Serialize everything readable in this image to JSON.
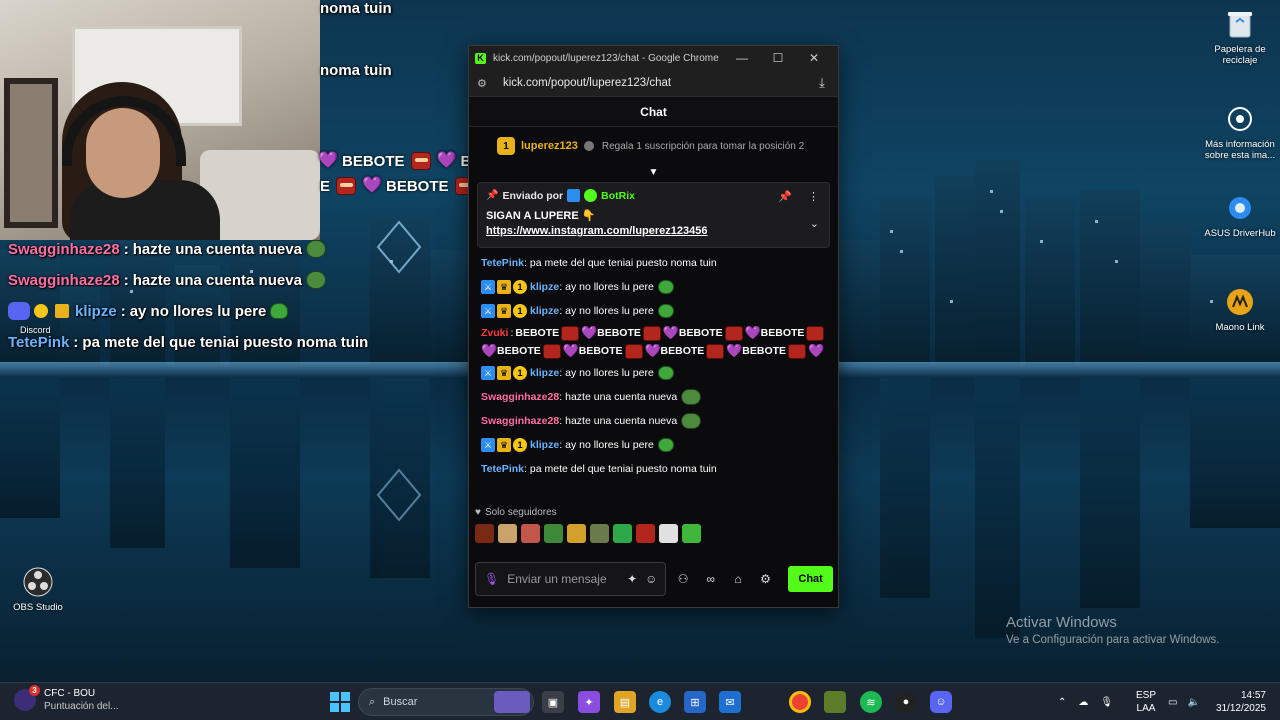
{
  "overlay": {
    "noma_top_1": "noma tuin",
    "noma_top_2": "noma tuin",
    "bebote_word": "BEBOTE",
    "bebote_cut": "E",
    "chat_lines": [
      {
        "user": "Swagginhaze28",
        "sep": " : ",
        "msg": "hazte una cuenta nueva"
      },
      {
        "user": "Swagginhaze28",
        "sep": " : ",
        "msg": "hazte una cuenta nueva"
      },
      {
        "user": "klipze",
        "sep": " : ",
        "msg": "ay no llores lu pere"
      },
      {
        "user": "TetePink",
        "sep": " : ",
        "msg": "pa mete del que teniai puesto noma tuin"
      }
    ],
    "discord_label": "Discord"
  },
  "desktop": {
    "icons": [
      {
        "label": "Papelera de reciclaje",
        "icon": "recycle-bin-icon"
      },
      {
        "label": "Más información sobre esta ima...",
        "icon": "info-camera-icon"
      },
      {
        "label": "ASUS DriverHub",
        "icon": "gear-icon"
      },
      {
        "label": "Maono Link",
        "icon": "maono-icon"
      },
      {
        "label": "OBS Studio",
        "icon": "obs-icon"
      }
    ],
    "activate_title": "Activar Windows",
    "activate_sub": "Ve a Configuración para activar Windows."
  },
  "chrome": {
    "window_title": "kick.com/popout/luperez123/chat - Google Chrome",
    "url": "kick.com/popout/luperez123/chat",
    "minimize": "—",
    "maximize": "☐",
    "close": "✕"
  },
  "chat": {
    "header": "Chat",
    "top_user": "luperez123",
    "sub_prompt": "Regala 1 suscripción para tomar la posición 2",
    "pinned": {
      "sent_by": "Enviado por",
      "bot_name": "BotRix",
      "line1": "SIGAN A LUPERE 👇",
      "link": "https://www.instagram.com/luperez123456"
    },
    "messages": [
      {
        "user": "TetePink",
        "cls": "u-tete",
        "badges": false,
        "text": "pa mete del que teniai puesto noma tuin",
        "emote": ""
      },
      {
        "user": "klipze",
        "cls": "u-klip",
        "badges": true,
        "text": "ay no llores lu pere",
        "emote": "pepe"
      },
      {
        "user": "klipze",
        "cls": "u-klip",
        "badges": true,
        "text": "ay no llores lu pere",
        "emote": "pepe"
      }
    ],
    "bebote_user": "Zvuki",
    "bebote_word": "BEBOTE",
    "messages_after": [
      {
        "user": "klipze",
        "cls": "u-klip",
        "badges": true,
        "text": "ay no llores lu pere",
        "emote": "pepe"
      },
      {
        "user": "Swagginhaze28",
        "cls": "u-swag",
        "badges": false,
        "text": "hazte una cuenta nueva",
        "emote": "frog"
      },
      {
        "user": "Swagginhaze28",
        "cls": "u-swag",
        "badges": false,
        "text": "hazte una cuenta nueva",
        "emote": "frog"
      },
      {
        "user": "klipze",
        "cls": "u-klip",
        "badges": true,
        "text": "ay no llores lu pere",
        "emote": "pepe"
      },
      {
        "user": "TetePink",
        "cls": "u-tete",
        "badges": false,
        "text": "pa mete del que teniai puesto noma tuin",
        "emote": ""
      }
    ],
    "followers_only": "Solo seguidores",
    "input_placeholder": "Enviar un mensaje",
    "send_label": "Chat",
    "emote_strip_colors": [
      "#7a2a14",
      "#c9a36b",
      "#c2564a",
      "#3f8a3a",
      "#d1a12a",
      "#6a7a4a",
      "#2fa84a",
      "#b3261e",
      "#e0e0e0",
      "#3fb83a"
    ]
  },
  "taskbar": {
    "weather_badge": "3",
    "weather_title": "CFC - BOU",
    "weather_sub": "Puntuación del...",
    "search_placeholder": "Buscar",
    "lang_1": "ESP",
    "lang_2": "LAA",
    "time": "14:57",
    "date": "31/12/2025"
  },
  "colors": {
    "kick_green": "#53fc18",
    "chat_bg": "#0b0b0d",
    "taskbar_bg": "#1c2430"
  }
}
